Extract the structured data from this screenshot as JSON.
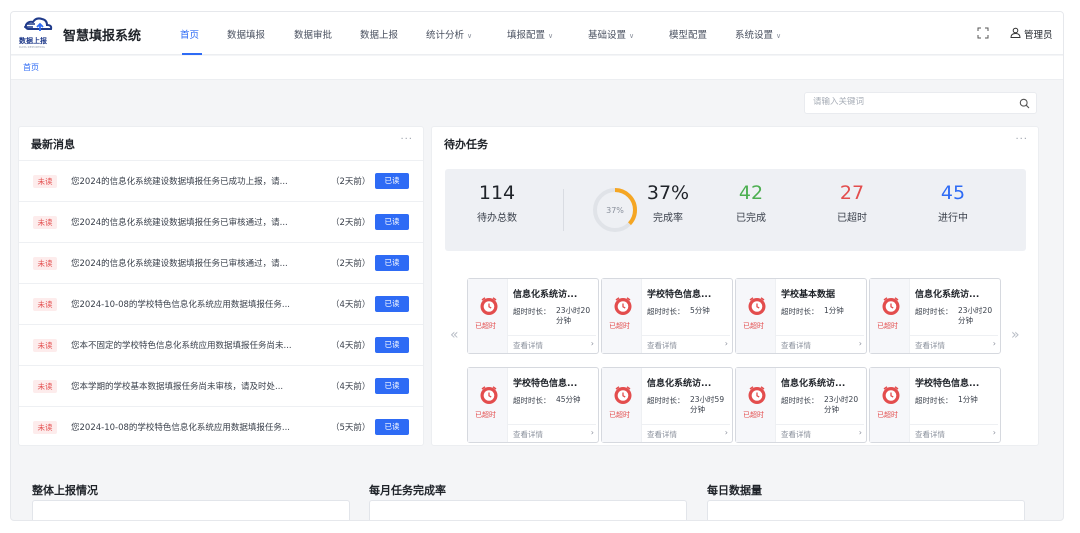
{
  "header": {
    "logo_text": "数据上报",
    "logo_subtext": "DATA REPORTING",
    "app_title": "智慧填报系统",
    "nav": [
      {
        "label": "首页",
        "dropdown": false,
        "active": true
      },
      {
        "label": "数据填报",
        "dropdown": false,
        "active": false
      },
      {
        "label": "数据审批",
        "dropdown": false,
        "active": false
      },
      {
        "label": "数据上报",
        "dropdown": false,
        "active": false
      },
      {
        "label": "统计分析",
        "dropdown": true,
        "active": false
      },
      {
        "label": "填报配置",
        "dropdown": true,
        "active": false
      },
      {
        "label": "基础设置",
        "dropdown": true,
        "active": false
      },
      {
        "label": "模型配置",
        "dropdown": false,
        "active": false
      },
      {
        "label": "系统设置",
        "dropdown": true,
        "active": false
      }
    ],
    "user_name": "管理员",
    "accent_color": "#2e6bf5"
  },
  "breadcrumb": {
    "label": "首页"
  },
  "search": {
    "placeholder": "请输入关键词",
    "value": ""
  },
  "messages_panel": {
    "title": "最新消息",
    "more": "···",
    "items": [
      {
        "tag": "未读",
        "text": "您2024的信息化系统建设数据填报任务已成功上报，请...",
        "time": "（2天前）",
        "action": "已读"
      },
      {
        "tag": "未读",
        "text": "您2024的信息化系统建设数据填报任务已审核通过，请...",
        "time": "（2天前）",
        "action": "已读"
      },
      {
        "tag": "未读",
        "text": "您2024的信息化系统建设数据填报任务已审核通过，请...",
        "time": "（2天前）",
        "action": "已读"
      },
      {
        "tag": "未读",
        "text": "您2024-10-08的学校特色信息化系统应用数据填报任务...",
        "time": "（4天前）",
        "action": "已读"
      },
      {
        "tag": "未读",
        "text": "您本不固定的学校特色信息化系统应用数据填报任务尚未...",
        "time": "（4天前）",
        "action": "已读"
      },
      {
        "tag": "未读",
        "text": "您本学期的学校基本数据填报任务尚未审核，请及时处...",
        "time": "（4天前）",
        "action": "已读"
      },
      {
        "tag": "未读",
        "text": "您2024-10-08的学校特色信息化系统应用数据填报任务...",
        "time": "（5天前）",
        "action": "已读"
      }
    ]
  },
  "tasks_panel": {
    "title": "待办任务",
    "more": "···",
    "stats": {
      "total": {
        "value": "114",
        "label": "待办总数"
      },
      "ring_label": "37%",
      "completion": {
        "value": "37%",
        "label": "完成率",
        "fraction": 0.37
      },
      "done": {
        "value": "42",
        "label": "已完成",
        "color": "#4caf50"
      },
      "overdue": {
        "value": "27",
        "label": "已超时",
        "color": "#e34d4d"
      },
      "in_progress": {
        "value": "45",
        "label": "进行中",
        "color": "#2e6bf5"
      }
    },
    "cards": [
      {
        "title": "信息化系统访...",
        "status": "已超时",
        "duration_label": "超时时长：",
        "duration": "23小时20分钟",
        "link": "查看详情"
      },
      {
        "title": "学校特色信息...",
        "status": "已超时",
        "duration_label": "超时时长：",
        "duration": "5分钟",
        "link": "查看详情"
      },
      {
        "title": "学校基本数据",
        "status": "已超时",
        "duration_label": "超时时长：",
        "duration": "1分钟",
        "link": "查看详情"
      },
      {
        "title": "信息化系统访...",
        "status": "已超时",
        "duration_label": "超时时长：",
        "duration": "23小时20分钟",
        "link": "查看详情"
      },
      {
        "title": "学校特色信息...",
        "status": "已超时",
        "duration_label": "超时时长：",
        "duration": "45分钟",
        "link": "查看详情"
      },
      {
        "title": "信息化系统访...",
        "status": "已超时",
        "duration_label": "超时时长：",
        "duration": "23小时59分钟",
        "link": "查看详情"
      },
      {
        "title": "信息化系统访...",
        "status": "已超时",
        "duration_label": "超时时长：",
        "duration": "23小时20分钟",
        "link": "查看详情"
      },
      {
        "title": "学校特色信息...",
        "status": "已超时",
        "duration_label": "超时时长：",
        "duration": "1分钟",
        "link": "查看详情"
      }
    ],
    "prev": "«",
    "next": "»"
  },
  "bottom": {
    "overall": "整体上报情况",
    "monthly": "每月任务完成率",
    "daily": "每日数据量"
  }
}
